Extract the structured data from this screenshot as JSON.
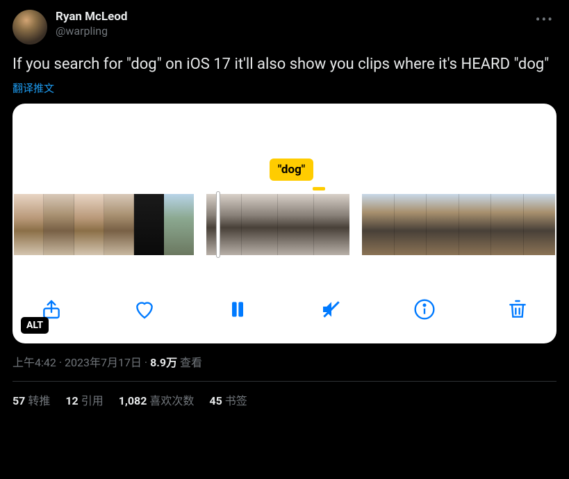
{
  "header": {
    "display_name": "Ryan McLeod",
    "handle": "@warpling"
  },
  "tweet_text": "If you search for \"dog\" on iOS 17 it'll also show you clips where it's HEARD \"dog\"",
  "translate_label": "翻译推文",
  "media": {
    "search_tag": "\"dog\"",
    "alt_badge": "ALT",
    "toolbar": {
      "share": "share",
      "like": "like",
      "pause": "pause",
      "mute": "mute",
      "info": "info",
      "trash": "trash"
    }
  },
  "meta": {
    "time": "上午4:42",
    "dot1": " · ",
    "date": "2023年7月17日",
    "dot2": " · ",
    "views_num": "8.9万",
    "views_label": " 查看"
  },
  "stats": {
    "retweets_num": "57",
    "retweets_label": "转推",
    "quotes_num": "12",
    "quotes_label": "引用",
    "likes_num": "1,082",
    "likes_label": "喜欢次数",
    "bookmarks_num": "45",
    "bookmarks_label": "书签"
  }
}
